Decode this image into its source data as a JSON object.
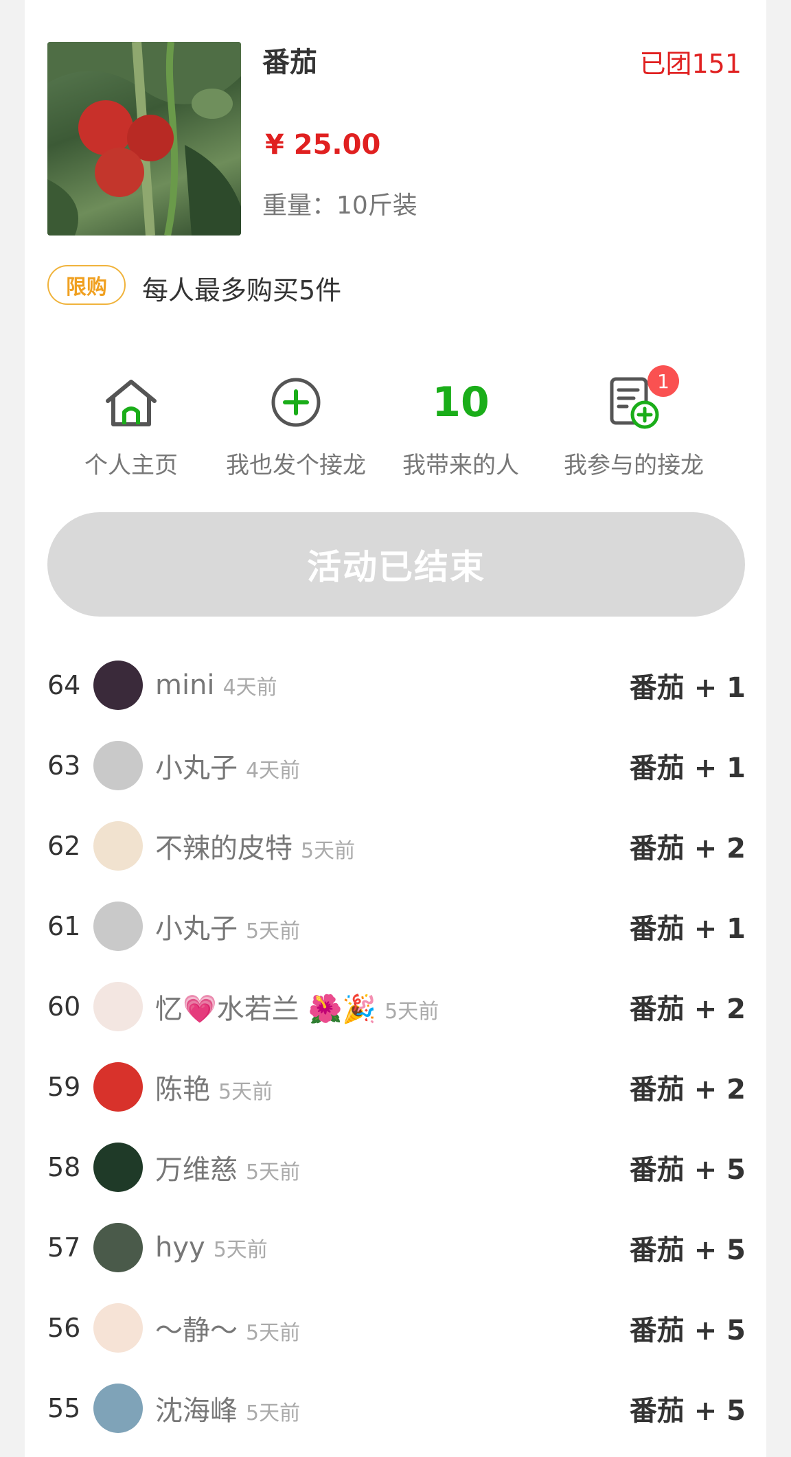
{
  "product": {
    "name": "番茄",
    "sold": "已团151",
    "price": "¥ 25.00",
    "weight": "重量：10斤装",
    "image_icon": "tomato-photo"
  },
  "limit": {
    "badge": "限购",
    "text": "每人最多购买5件"
  },
  "actions": [
    {
      "label": "个人主页",
      "icon": "home-icon"
    },
    {
      "label": "我也发个接龙",
      "icon": "plus-circle-icon"
    },
    {
      "label": "我带来的人",
      "value": "10"
    },
    {
      "label": "我参与的接龙",
      "icon": "document-add-icon",
      "badge": "1"
    }
  ],
  "ended_button": "活动已结束",
  "orders": [
    {
      "index": "64",
      "user": "mini",
      "time": "4天前",
      "qty": "番茄 + 1",
      "avatar_color": "#3a2a3a"
    },
    {
      "index": "63",
      "user": "小丸子",
      "time": "4天前",
      "qty": "番茄 + 1",
      "avatar_color": "#c9c9c9"
    },
    {
      "index": "62",
      "user": "不辣的皮特",
      "time": "5天前",
      "qty": "番茄 + 2",
      "avatar_color": "#f1e2cf"
    },
    {
      "index": "61",
      "user": "小丸子",
      "time": "5天前",
      "qty": "番茄 + 1",
      "avatar_color": "#c9c9c9"
    },
    {
      "index": "60",
      "user": "忆💗水若兰 🌺🎉",
      "time": "5天前",
      "qty": "番茄 + 2",
      "avatar_color": "#f3e6e1"
    },
    {
      "index": "59",
      "user": "陈艳",
      "time": "5天前",
      "qty": "番茄 + 2",
      "avatar_color": "#d8322b"
    },
    {
      "index": "58",
      "user": "万维慈",
      "time": "5天前",
      "qty": "番茄 + 5",
      "avatar_color": "#1f3a28"
    },
    {
      "index": "57",
      "user": "hyy",
      "time": "5天前",
      "qty": "番茄 + 5",
      "avatar_color": "#4a5a4a"
    },
    {
      "index": "56",
      "user": "～静～",
      "time": "5天前",
      "qty": "番茄 + 5",
      "avatar_color": "#f6e3d6"
    },
    {
      "index": "55",
      "user": "沈海峰",
      "time": "5天前",
      "qty": "番茄 + 5",
      "avatar_color": "#7fa3b8"
    }
  ]
}
